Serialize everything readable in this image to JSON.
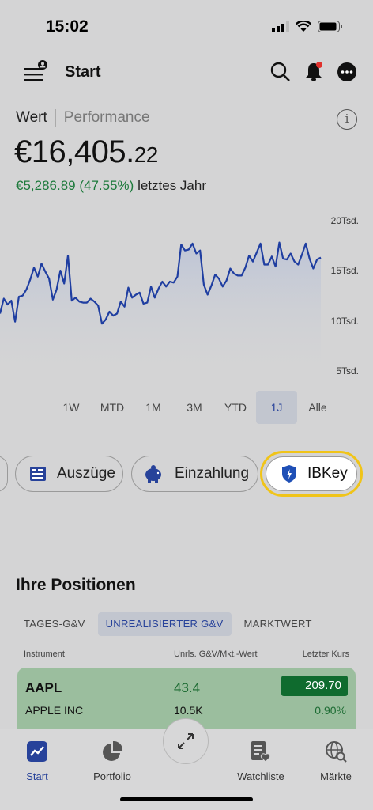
{
  "status": {
    "time": "15:02"
  },
  "header": {
    "title": "Start"
  },
  "value_tabs": {
    "value": "Wert",
    "performance": "Performance"
  },
  "portfolio": {
    "value_main": "€16,405.",
    "value_cents": "22",
    "change_amount": "€5,286.89 (47.55%)",
    "change_label": "letztes Jahr"
  },
  "chart_data": {
    "type": "line",
    "ylim": [
      5000,
      20000
    ],
    "y_ticks": [
      "20Tsd.",
      "15Tsd.",
      "10Tsd.",
      "5Tsd."
    ],
    "y_tick_values": [
      20000,
      15000,
      10000,
      5000
    ],
    "grid": false,
    "color": "#1f3ea1",
    "values": [
      10800,
      12300,
      11700,
      12100,
      10000,
      12500,
      12600,
      13200,
      14200,
      15400,
      14500,
      15800,
      15000,
      14300,
      12200,
      13200,
      15100,
      13800,
      16600,
      12100,
      12400,
      12000,
      11900,
      11900,
      12300,
      12000,
      11600,
      9800,
      10200,
      11000,
      10600,
      10800,
      12000,
      11500,
      13400,
      12400,
      12700,
      12900,
      11800,
      11900,
      13500,
      12400,
      13300,
      14000,
      13500,
      14000,
      13900,
      14500,
      17700,
      17100,
      17200,
      17800,
      16800,
      17100,
      13700,
      12700,
      13600,
      14700,
      14300,
      13500,
      14100,
      15300,
      14800,
      14600,
      14600,
      15400,
      16600,
      16000,
      16900,
      17800,
      15700,
      15700,
      16500,
      15500,
      17900,
      16300,
      16200,
      16800,
      16000,
      15700,
      16700,
      17800,
      16300,
      15300,
      16200,
      16400
    ]
  },
  "ranges": [
    "1W",
    "MTD",
    "1M",
    "3M",
    "YTD",
    "1J",
    "Alle"
  ],
  "active_range": "1J",
  "actions": {
    "statements": "Auszüge",
    "deposit": "Einzahlung",
    "ibkey": "IBKey"
  },
  "positions": {
    "title": "Ihre Positionen",
    "tabs": [
      "TAGES-G&V",
      "UNREALISIERTER G&V",
      "MARKTWERT"
    ],
    "active_tab": "UNREALISIERTER G&V",
    "columns": {
      "instrument": "Instrument",
      "pnl": "Unrls. G&V/Mkt.-Wert",
      "last": "Letzter Kurs"
    },
    "rows": [
      {
        "symbol": "AAPL",
        "name": "APPLE INC",
        "pnl": "43.4",
        "market_value": "10.5K",
        "last": "209.70",
        "change": "0.90%"
      }
    ]
  },
  "nav": {
    "start": "Start",
    "portfolio": "Portfolio",
    "watchlist": "Watchliste",
    "markets": "Märkte"
  },
  "colors": {
    "accent": "#27429a",
    "positive": "#1d7a3c",
    "highlight": "#f0c419"
  }
}
